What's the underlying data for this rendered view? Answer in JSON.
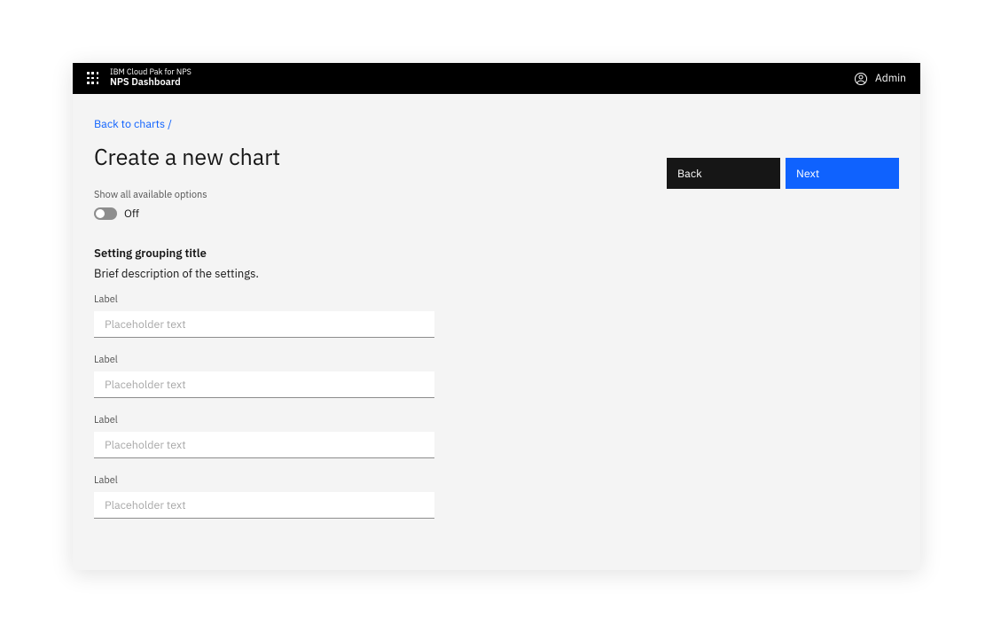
{
  "header": {
    "subtitle": "IBM Cloud Pak for NPS",
    "title": "NPS Dashboard",
    "user_label": "Admin"
  },
  "breadcrumb": "Back to charts /",
  "page_title": "Create a new chart",
  "toggle": {
    "caption": "Show all available options",
    "state_label": "Off"
  },
  "group": {
    "title": "Setting grouping title",
    "description": "Brief description of the settings."
  },
  "fields": [
    {
      "label": "Label",
      "placeholder": "Placeholder text",
      "value": ""
    },
    {
      "label": "Label",
      "placeholder": "Placeholder text",
      "value": ""
    },
    {
      "label": "Label",
      "placeholder": "Placeholder text",
      "value": ""
    },
    {
      "label": "Label",
      "placeholder": "Placeholder text",
      "value": ""
    }
  ],
  "buttons": {
    "back": "Back",
    "next": "Next"
  }
}
